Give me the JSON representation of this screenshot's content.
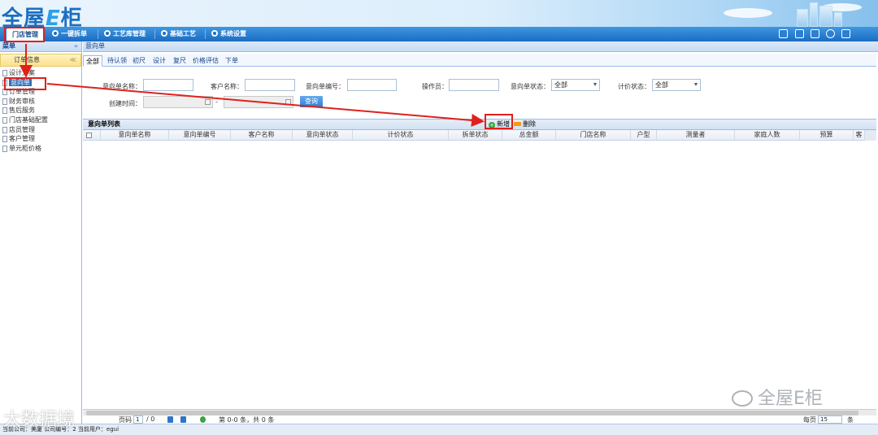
{
  "app": {
    "logo_text_1": "全屋",
    "logo_text_e": "E",
    "logo_text_2": "柜"
  },
  "nav": {
    "active": "门店管理",
    "items": [
      "一键拆单",
      "工艺库管理",
      "基础工艺",
      "系统设置"
    ]
  },
  "sidebar": {
    "header": "菜单",
    "collapse": "«",
    "group": "订单信息",
    "group_toggle": "≪",
    "items": [
      "设计方案",
      "意向单",
      "订单管理",
      "财务审核",
      "售后服务",
      "门店基础配置",
      "店员管理",
      "客户管理",
      "单元柜价格"
    ],
    "active_index": 1
  },
  "main": {
    "breadcrumb": "意向单",
    "tabs": [
      "全部",
      "待认领",
      "初尺",
      "设计",
      "复尺",
      "价格评估",
      "下单"
    ],
    "active_tab": 0
  },
  "search": {
    "name_label": "意向单名称：",
    "customer_label": "客户名称：",
    "number_label": "意向单编号：",
    "operator_label": "操作员：",
    "status_label": "意向单状态：",
    "status_value": "全部",
    "price_status_label": "计价状态：",
    "price_status_value": "全部",
    "created_label": "创建时间：",
    "range_sep": "-",
    "query_button": "查询"
  },
  "grid": {
    "title": "意向单列表",
    "add_button": "新增",
    "delete_button": "删除",
    "columns": [
      "意向单名称",
      "意向单编号",
      "客户名称",
      "意向单状态",
      "计价状态",
      "拆单状态",
      "总金额",
      "门店名称",
      "户型",
      "测量者",
      "家庭人数",
      "预算",
      "客"
    ],
    "rows": []
  },
  "pager": {
    "page_label": "页码",
    "page_value": "1",
    "page_total": "/ 0",
    "summary": "第 0-0 条，共 0 条",
    "per_page_label": "每页",
    "per_page_value": "15",
    "per_page_unit": "条"
  },
  "status": {
    "text": "当前公司：美厦  公司编号：2  当前用户：egui"
  },
  "watermark": {
    "text_right": "全屋E柜",
    "text_left": "大数据境"
  }
}
